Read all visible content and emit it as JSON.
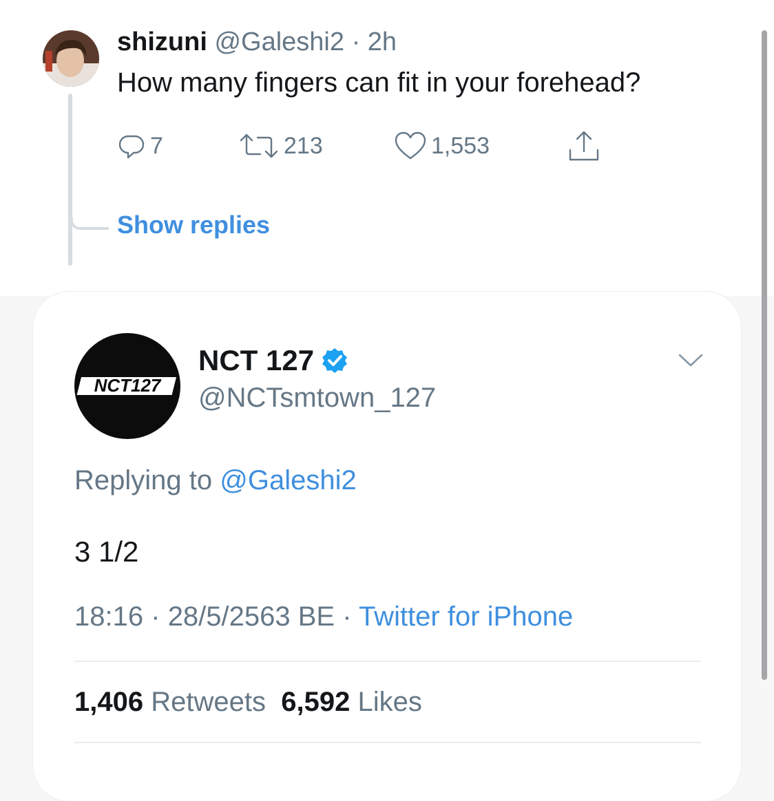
{
  "tweet": {
    "display_name": "shizuni",
    "handle": "@Galeshi2",
    "separator": "·",
    "time": "2h",
    "text": "How many fingers can fit in your forehead?",
    "replies": "7",
    "retweets": "213",
    "likes": "1,553",
    "show_replies": "Show replies",
    "icons": [
      "reply-icon",
      "retweet-icon",
      "like-icon",
      "share-icon"
    ]
  },
  "reply": {
    "display_name": "NCT 127",
    "verified": true,
    "handle": "@NCTsmtown_127",
    "avatar_logo_text": "NCT127",
    "replying_label": "Replying to",
    "replying_to": "@Galeshi2",
    "text": "3 1/2",
    "time": "18:16",
    "date": "28/5/2563 BE",
    "separator": "·",
    "source": "Twitter for iPhone",
    "retweet_count": "1,406",
    "retweet_label": "Retweets",
    "like_count": "6,592",
    "like_label": "Likes"
  },
  "colors": {
    "accent": "#3f8fdf",
    "muted": "#657786",
    "text": "#14171a",
    "verified": "#1da1f2"
  }
}
